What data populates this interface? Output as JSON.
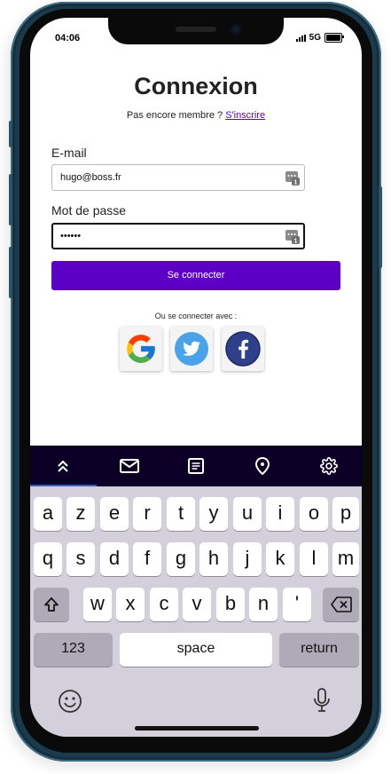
{
  "status_bar": {
    "time": "04:06",
    "network": "5G"
  },
  "login": {
    "title": "Connexion",
    "subtitle_text": "Pas encore membre ?",
    "signup_link": "S'inscrire",
    "email_label": "E-mail",
    "email_value": "hugo@boss.fr",
    "password_label": "Mot de passe",
    "password_value": "••••••",
    "submit_label": "Se connecter",
    "social_label": "Ou se connecter avec :",
    "social_buttons": [
      "google-icon",
      "twitter-icon",
      "facebook-icon"
    ]
  },
  "accessory_toolbar": {
    "icons": [
      "chevrons-up-icon",
      "mail-icon",
      "notes-icon",
      "location-pin-icon",
      "gear-icon"
    ],
    "active_index": 0
  },
  "keyboard": {
    "row1": [
      "a",
      "z",
      "e",
      "r",
      "t",
      "y",
      "u",
      "i",
      "o",
      "p"
    ],
    "row2": [
      "q",
      "s",
      "d",
      "f",
      "g",
      "h",
      "j",
      "k",
      "l",
      "m"
    ],
    "row3": [
      "w",
      "x",
      "c",
      "v",
      "b",
      "n",
      "'"
    ],
    "numbers_key": "123",
    "space_key": "space",
    "return_key": "return"
  },
  "colors": {
    "primary": "#5b00c4",
    "link": "#5b00b7",
    "toolbar": "#0c0026",
    "keyboard_bg": "#d3d0db"
  }
}
